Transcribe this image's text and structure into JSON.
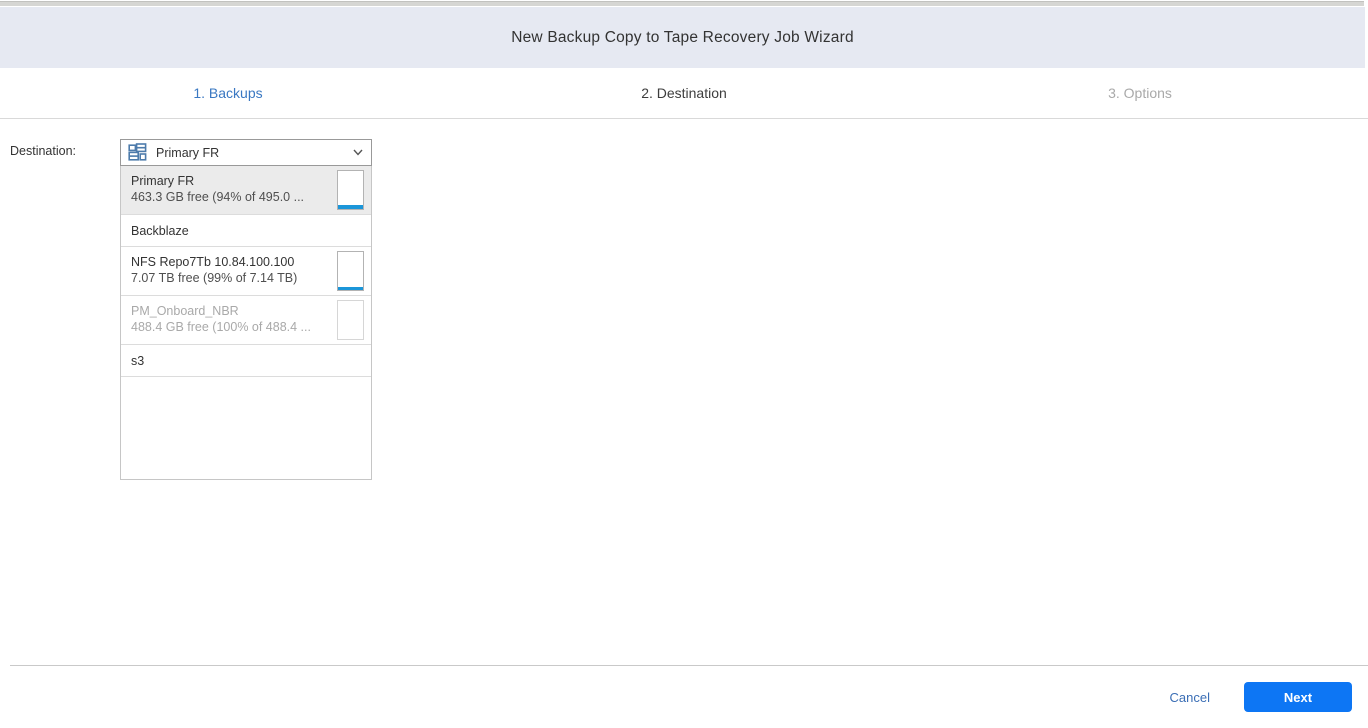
{
  "window": {
    "title": "New Backup Copy to Tape Recovery Job Wizard"
  },
  "steps": [
    {
      "label": "1. Backups",
      "state": "active"
    },
    {
      "label": "2. Destination",
      "state": "current"
    },
    {
      "label": "3. Options",
      "state": "disabled"
    }
  ],
  "form": {
    "destination_label": "Destination:",
    "select": {
      "value": "Primary FR",
      "icon": "repository-icon"
    }
  },
  "dropdown": {
    "items": [
      {
        "name": "Primary FR",
        "detail": "463.3 GB free (94% of 495.0 ...",
        "selected": true,
        "disabled": false,
        "has_gauge": true,
        "gauge_used_pct": 10
      },
      {
        "name": "Backblaze",
        "detail": "",
        "selected": false,
        "disabled": false,
        "has_gauge": false,
        "gauge_used_pct": 0
      },
      {
        "name": "NFS Repo7Tb 10.84.100.100",
        "detail": "7.07 TB free (99% of 7.14 TB)",
        "selected": false,
        "disabled": false,
        "has_gauge": true,
        "gauge_used_pct": 7
      },
      {
        "name": "PM_Onboard_NBR",
        "detail": "488.4 GB free (100% of 488.4 ...",
        "selected": false,
        "disabled": true,
        "has_gauge": true,
        "gauge_used_pct": 0
      },
      {
        "name": "s3",
        "detail": "",
        "selected": false,
        "disabled": false,
        "has_gauge": false,
        "gauge_used_pct": 0
      }
    ]
  },
  "footer": {
    "cancel_label": "Cancel",
    "next_label": "Next"
  },
  "colors": {
    "header_bg": "#e6e9f2",
    "step_active": "#3a78c2",
    "step_disabled": "#a9a9a9",
    "gauge_fill": "#1b96d9",
    "next_button_bg": "#0d76f4",
    "cancel_link": "#3b6eb5",
    "selected_item_bg": "#ebebeb"
  }
}
